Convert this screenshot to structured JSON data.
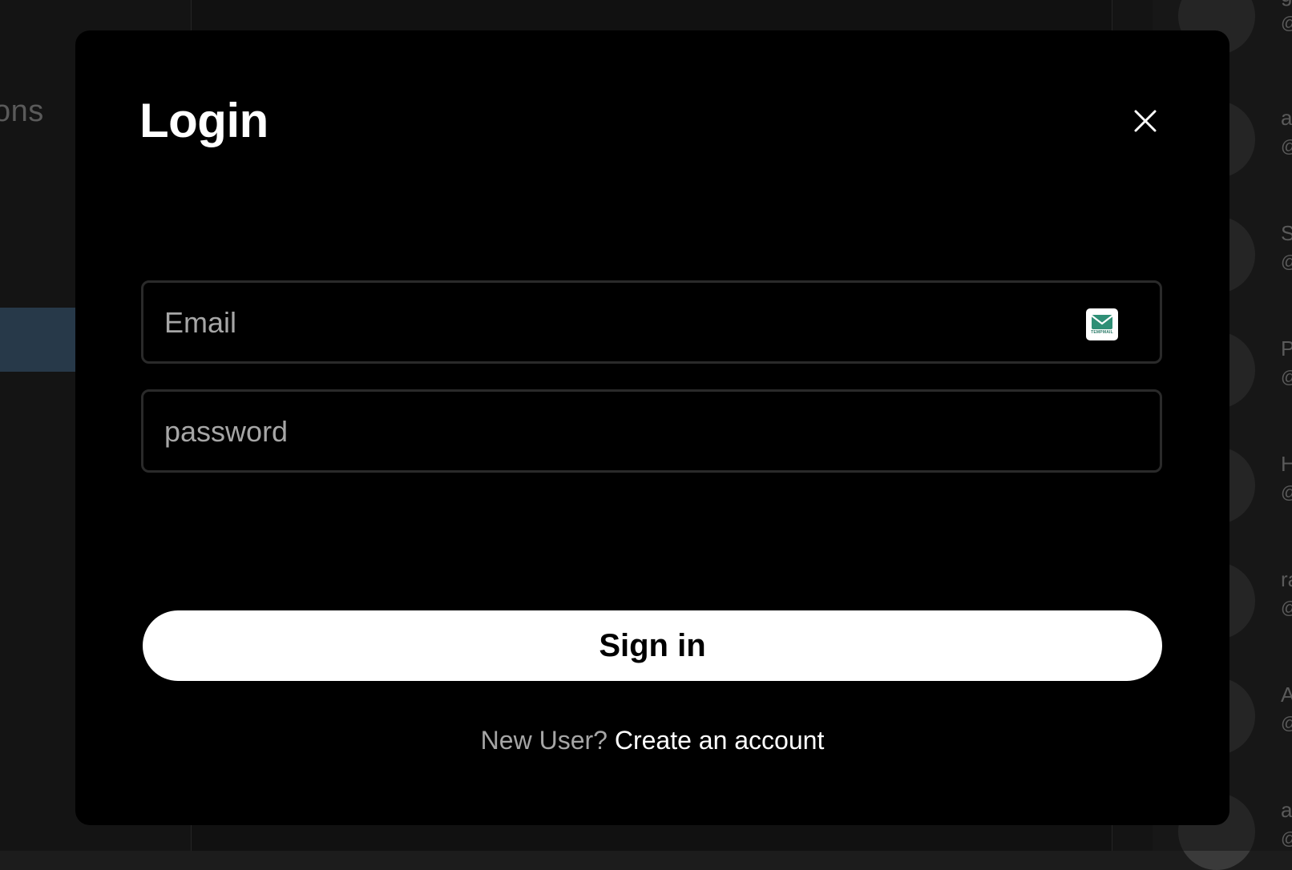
{
  "background": {
    "left_panel_text": "ons",
    "right_users": [
      {
        "initial": "g",
        "at": "@"
      },
      {
        "initial": "a",
        "at": "@"
      },
      {
        "initial": "S",
        "at": "@"
      },
      {
        "initial": "P",
        "at": "@"
      },
      {
        "initial": "H",
        "at": "@"
      },
      {
        "initial": "ra",
        "at": "@"
      },
      {
        "initial": "A",
        "at": "@"
      },
      {
        "initial": "a",
        "at": "@"
      }
    ]
  },
  "login_modal": {
    "title": "Login",
    "close_icon": "close-icon",
    "email": {
      "placeholder": "Email",
      "value": "",
      "extension_icon": "tempmail-icon",
      "extension_label": "TEMPMAIL"
    },
    "password": {
      "placeholder": "password",
      "value": ""
    },
    "signin_label": "Sign in",
    "signup_prompt": "New User?",
    "signup_link": "Create an account"
  },
  "colors": {
    "modal_bg": "#000000",
    "button_bg": "#ffffff",
    "muted_text": "#a6a6a6",
    "active_nav": "#3d5871"
  }
}
